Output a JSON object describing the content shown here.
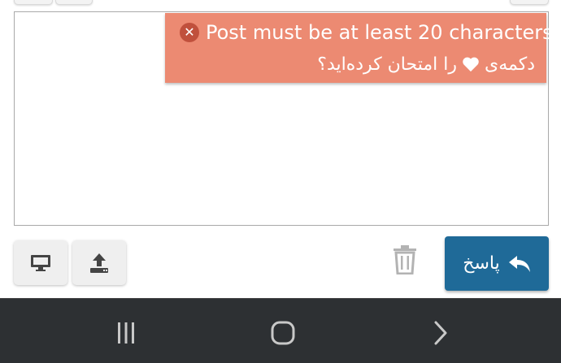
{
  "popup": {
    "error_message": "Post must be at least 20 characters",
    "hint_before": "دکمه‌ی",
    "hint_after": "را امتحان کرده‌اید؟",
    "color": "#ec8a72"
  },
  "actions": {
    "reply_label": "پاسخ",
    "reply_color": "#1f6a98"
  },
  "icons": {
    "close": "close-circle-icon",
    "heart": "heart-icon",
    "preview": "desktop-icon",
    "upload": "upload-icon",
    "trash": "trash-icon",
    "reply": "reply-arrow-icon",
    "nav_recents": "recents-icon",
    "nav_home": "home-icon",
    "nav_back": "back-chevron-icon"
  },
  "navbar": {
    "color": "#2d3033"
  }
}
